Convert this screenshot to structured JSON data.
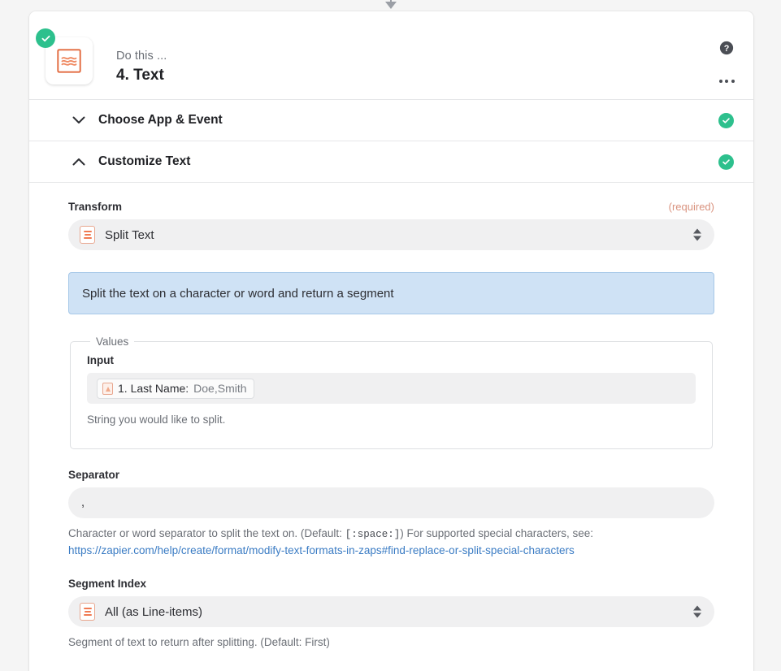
{
  "connector": {
    "icon": "arrow-down-icon"
  },
  "header": {
    "status_icon": "check-circle-icon",
    "app_icon": "text-formatter-icon",
    "eyebrow": "Do this ...",
    "title": "4. Text",
    "help_icon": "question-circle-icon",
    "more_icon": "ellipsis-icon"
  },
  "sections": [
    {
      "id": "choose-app-event",
      "title": "Choose App & Event",
      "chevron": "chevron-down-icon",
      "status_icon": "check-circle-icon",
      "expanded": false
    },
    {
      "id": "customize-text",
      "title": "Customize Text",
      "chevron": "chevron-up-icon",
      "status_icon": "check-circle-icon",
      "expanded": true
    }
  ],
  "form": {
    "transform": {
      "label": "Transform",
      "required_tag": "(required)",
      "value": "Split Text",
      "option_icon": "text-lines-icon",
      "spinner_icon": "select-spinner-icon"
    },
    "description_callout": "Split the text on a character or word and return a segment",
    "values": {
      "legend": "Values",
      "input": {
        "label": "Input",
        "token_icon": "data-field-icon",
        "token_key": "1. Last Name:",
        "token_value": "Doe,Smith",
        "help": "String you would like to split."
      }
    },
    "separator": {
      "label": "Separator",
      "value": ",",
      "placeholder": "",
      "help_before": "Character or word separator to split the text on. (Default:",
      "help_code": "[:space:]",
      "help_after": ") For supported special characters, see:",
      "help_link": "https://zapier.com/help/create/format/modify-text-formats-in-zaps#find-replace-or-split-special-characters"
    },
    "segment_index": {
      "label": "Segment Index",
      "value": "All (as Line-items)",
      "option_icon": "text-lines-icon",
      "spinner_icon": "select-spinner-icon",
      "help": "Segment of text to return after splitting. (Default: First)"
    }
  },
  "colors": {
    "brand_orange": "#f07a52",
    "success_green": "#2dc08d",
    "callout_blue": "#cfe2f5",
    "link_blue": "#3b7cc4",
    "required_salmon": "#d9927e"
  }
}
